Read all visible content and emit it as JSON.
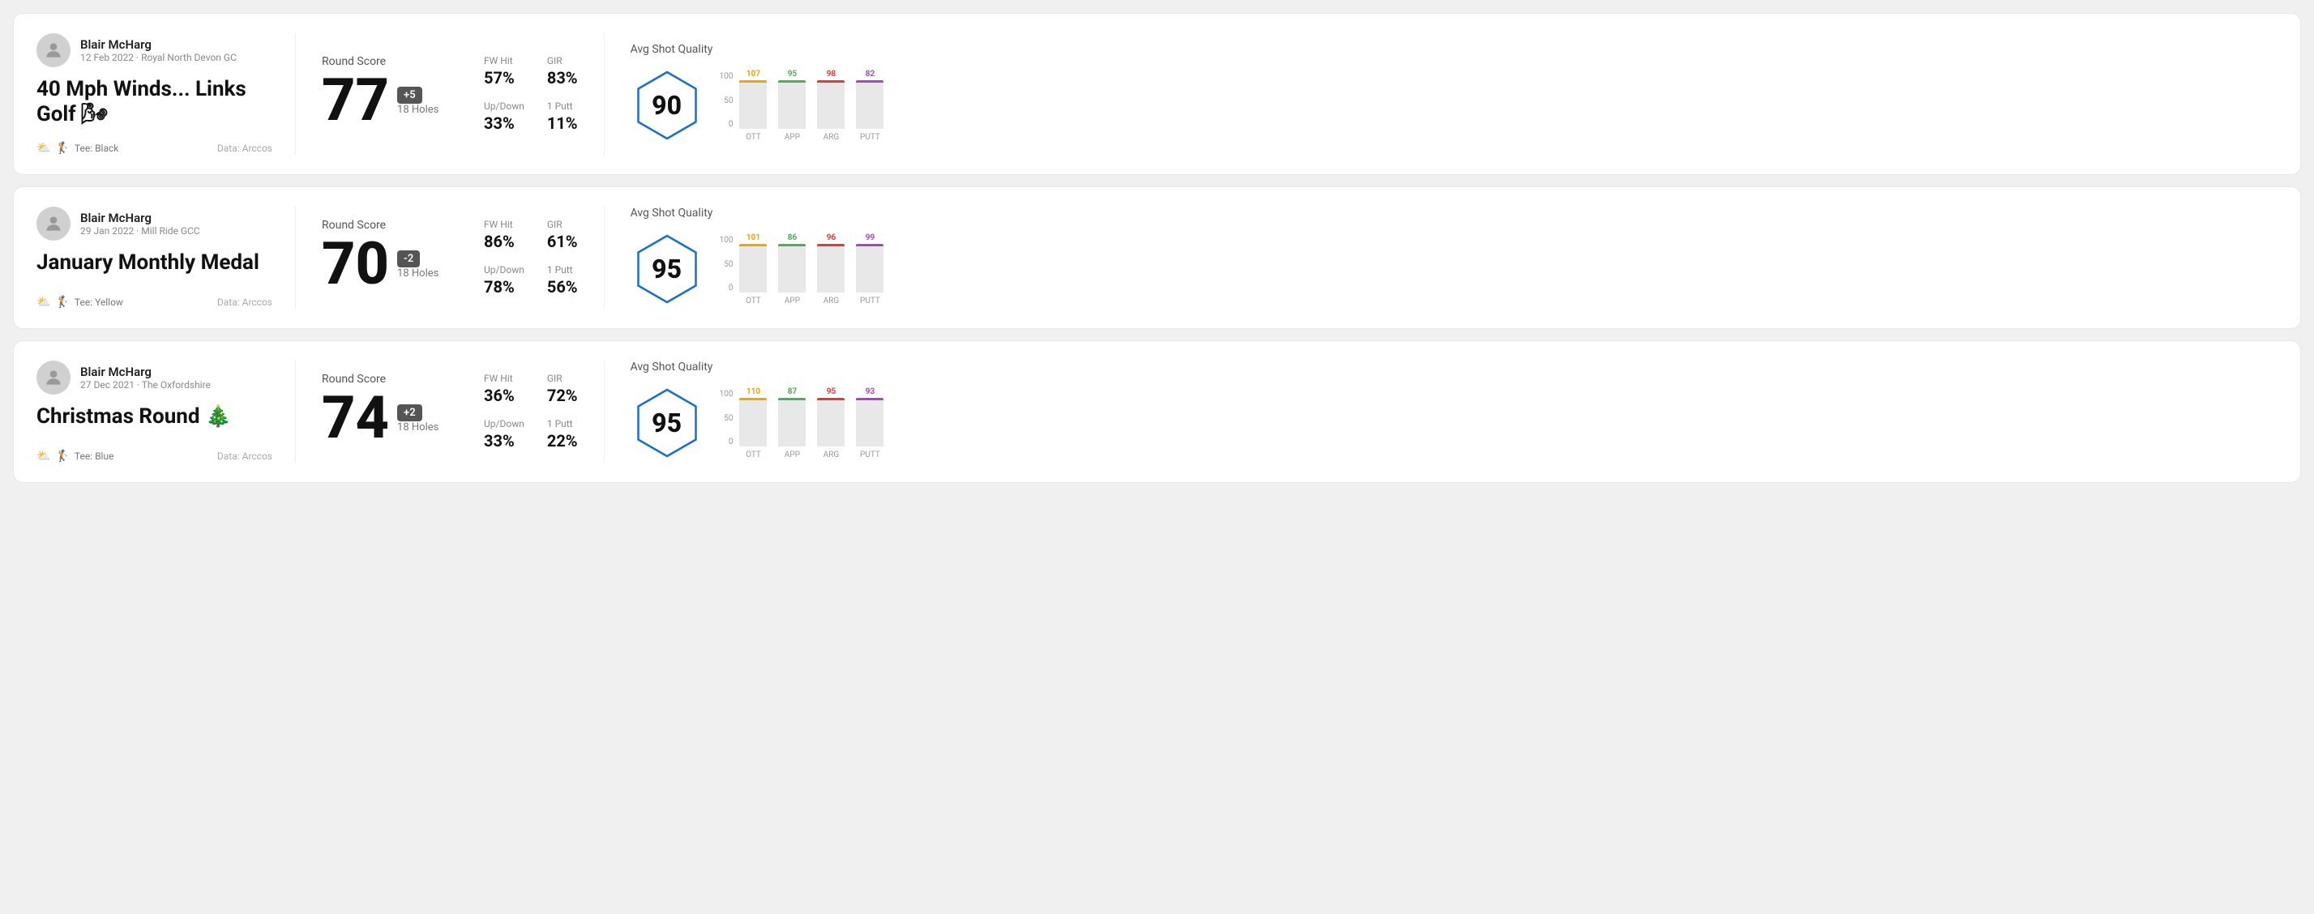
{
  "rounds": [
    {
      "id": "round-1",
      "user_name": "Blair McHarg",
      "user_meta": "12 Feb 2022 · Royal North Devon GC",
      "title": "40 Mph Winds... Links Golf 🌬",
      "tee": "Tee: Black",
      "data_source": "Data: Arccos",
      "score": "77",
      "score_diff": "+5",
      "score_diff_positive": true,
      "holes": "18 Holes",
      "fw_hit": "57%",
      "gir": "83%",
      "up_down": "33%",
      "one_putt": "11%",
      "avg_shot_quality": "90",
      "chart": {
        "bars": [
          {
            "label": "OTT",
            "value": 107,
            "color": "#f0a500"
          },
          {
            "label": "APP",
            "value": 95,
            "color": "#4caf50"
          },
          {
            "label": "ARG",
            "value": 98,
            "color": "#e53935"
          },
          {
            "label": "PUTT",
            "value": 82,
            "color": "#ab47bc"
          }
        ]
      }
    },
    {
      "id": "round-2",
      "user_name": "Blair McHarg",
      "user_meta": "29 Jan 2022 · Mill Ride GCC",
      "title": "January Monthly Medal",
      "tee": "Tee: Yellow",
      "data_source": "Data: Arccos",
      "score": "70",
      "score_diff": "-2",
      "score_diff_positive": false,
      "holes": "18 Holes",
      "fw_hit": "86%",
      "gir": "61%",
      "up_down": "78%",
      "one_putt": "56%",
      "avg_shot_quality": "95",
      "chart": {
        "bars": [
          {
            "label": "OTT",
            "value": 101,
            "color": "#f0a500"
          },
          {
            "label": "APP",
            "value": 86,
            "color": "#4caf50"
          },
          {
            "label": "ARG",
            "value": 96,
            "color": "#e53935"
          },
          {
            "label": "PUTT",
            "value": 99,
            "color": "#ab47bc"
          }
        ]
      }
    },
    {
      "id": "round-3",
      "user_name": "Blair McHarg",
      "user_meta": "27 Dec 2021 · The Oxfordshire",
      "title": "Christmas Round 🎄",
      "tee": "Tee: Blue",
      "data_source": "Data: Arccos",
      "score": "74",
      "score_diff": "+2",
      "score_diff_positive": true,
      "holes": "18 Holes",
      "fw_hit": "36%",
      "gir": "72%",
      "up_down": "33%",
      "one_putt": "22%",
      "avg_shot_quality": "95",
      "chart": {
        "bars": [
          {
            "label": "OTT",
            "value": 110,
            "color": "#f0a500"
          },
          {
            "label": "APP",
            "value": 87,
            "color": "#4caf50"
          },
          {
            "label": "ARG",
            "value": 95,
            "color": "#e53935"
          },
          {
            "label": "PUTT",
            "value": 93,
            "color": "#ab47bc"
          }
        ]
      }
    }
  ],
  "labels": {
    "round_score": "Round Score",
    "fw_hit": "FW Hit",
    "gir": "GIR",
    "up_down": "Up/Down",
    "one_putt": "1 Putt",
    "avg_shot_quality": "Avg Shot Quality",
    "y_axis": [
      "100",
      "50",
      "0"
    ]
  }
}
